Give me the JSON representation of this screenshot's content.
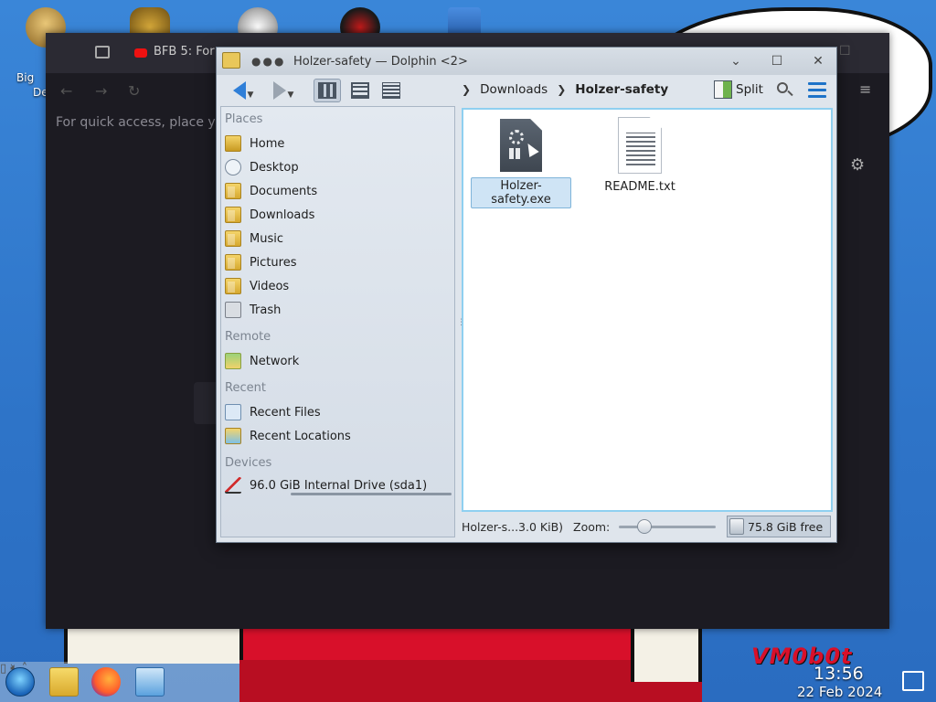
{
  "desktop": {
    "icon_label_1": "Big",
    "icon_label_2": "De",
    "watermark": "VM0b0t"
  },
  "browser": {
    "tab_title": "BFB 5: For",
    "quick_access_hint": "For quick access, place yo"
  },
  "dolphin": {
    "title": "Holzer-safety — Dolphin <2>",
    "breadcrumbs": [
      "Downloads",
      "Holzer-safety"
    ],
    "toolbar": {
      "split_label": "Split"
    },
    "places": {
      "sections": {
        "places": "Places",
        "remote": "Remote",
        "recent": "Recent",
        "devices": "Devices"
      },
      "items": [
        {
          "label": "Home",
          "icon": "home-icon"
        },
        {
          "label": "Desktop",
          "icon": "desktop-icon"
        },
        {
          "label": "Documents",
          "icon": "folder-icon"
        },
        {
          "label": "Downloads",
          "icon": "folder-icon"
        },
        {
          "label": "Music",
          "icon": "folder-icon"
        },
        {
          "label": "Pictures",
          "icon": "folder-icon"
        },
        {
          "label": "Videos",
          "icon": "folder-icon"
        },
        {
          "label": "Trash",
          "icon": "trash-icon"
        }
      ],
      "remote_items": [
        {
          "label": "Network",
          "icon": "network-icon"
        }
      ],
      "recent_items": [
        {
          "label": "Recent Files",
          "icon": "recent-files-icon"
        },
        {
          "label": "Recent Locations",
          "icon": "recent-locations-icon"
        }
      ],
      "devices": [
        {
          "label": "96.0 GiB Internal Drive (sda1)",
          "icon": "drive-icon"
        }
      ]
    },
    "files": [
      {
        "name": "Holzer-safety.exe",
        "icon": "exe-icon",
        "selected": true
      },
      {
        "name": "README.txt",
        "icon": "text-file-icon",
        "selected": false
      }
    ],
    "status": {
      "selection": "Holzer-s...3.0 KiB)",
      "zoom_label": "Zoom:",
      "free_space": "75.8 GiB free"
    }
  },
  "taskbar": {
    "time": "13:56",
    "date": "22 Feb 2024"
  },
  "colors": {
    "accent": "#2f7fd8",
    "selection": "#cfe4f5",
    "wallpaper": "#2e74c8",
    "brand_red": "#d8102a"
  }
}
